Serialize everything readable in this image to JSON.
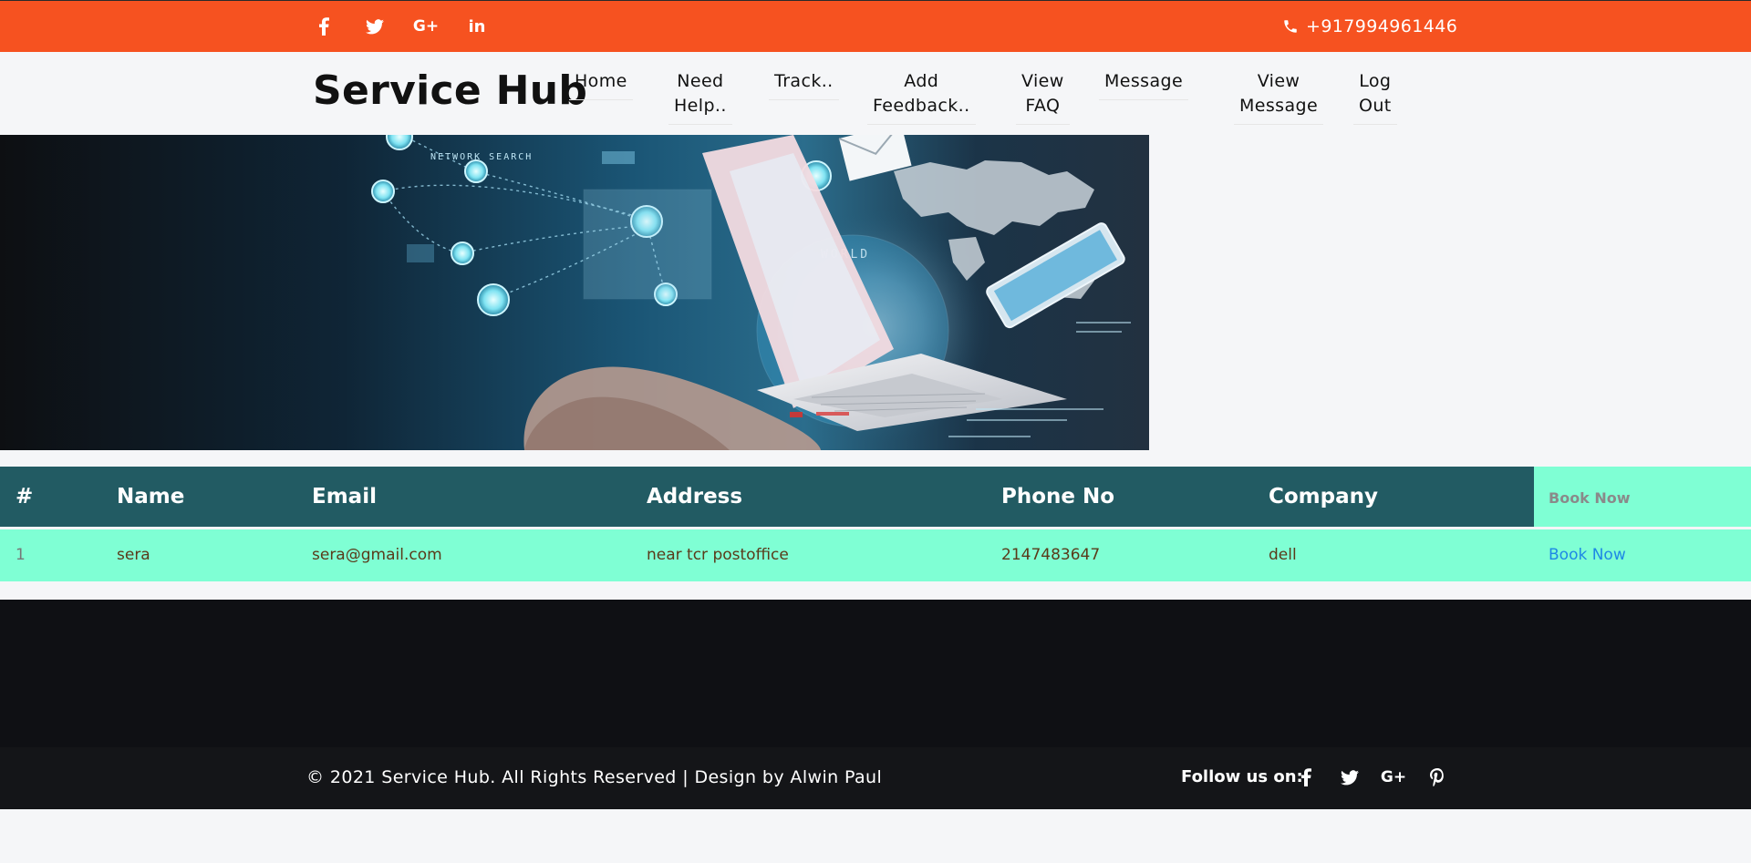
{
  "topbar": {
    "social": [
      {
        "icon": "facebook-icon",
        "glyph": "f"
      },
      {
        "icon": "twitter-icon",
        "glyph": "🐦"
      },
      {
        "icon": "google-plus-icon",
        "glyph": "G+"
      },
      {
        "icon": "linkedin-icon",
        "glyph": "in"
      }
    ],
    "phone": "+917994961446",
    "phone_icon": "phone-icon",
    "color": "#f65220"
  },
  "header": {
    "brand": "Service Hub",
    "nav": [
      {
        "label": "Home"
      },
      {
        "label": "Need\nHelp.."
      },
      {
        "label": "Track.."
      },
      {
        "label": "Add\nFeedback.."
      },
      {
        "label": "View\nFAQ"
      },
      {
        "label": "Message"
      },
      {
        "label": "View\nMessage"
      },
      {
        "label": "Log\nOut"
      }
    ]
  },
  "hero": {
    "overlay_words": [
      "NETWORK SEARCH",
      "WORLD"
    ]
  },
  "table": {
    "headers": [
      "#",
      "Name",
      "Email",
      "Address",
      "Phone No",
      "Company",
      "Book Now"
    ],
    "rows": [
      {
        "idx": "1",
        "name": "sera",
        "email": "sera@gmail.com",
        "address": "near tcr postoffice",
        "phone": "2147483647",
        "company": "dell",
        "action": "Book Now"
      }
    ],
    "head_color": "#225b63",
    "row_color": "#7fffd4"
  },
  "footer": {
    "copyright": "© 2021 Service Hub. All Rights Reserved | Design by Alwin Paul",
    "follow_label": "Follow us on:",
    "social": [
      {
        "icon": "facebook-icon",
        "glyph": "f"
      },
      {
        "icon": "twitter-icon",
        "glyph": "🐦"
      },
      {
        "icon": "google-plus-icon",
        "glyph": "G+"
      },
      {
        "icon": "pinterest-icon",
        "glyph": "P"
      }
    ]
  }
}
